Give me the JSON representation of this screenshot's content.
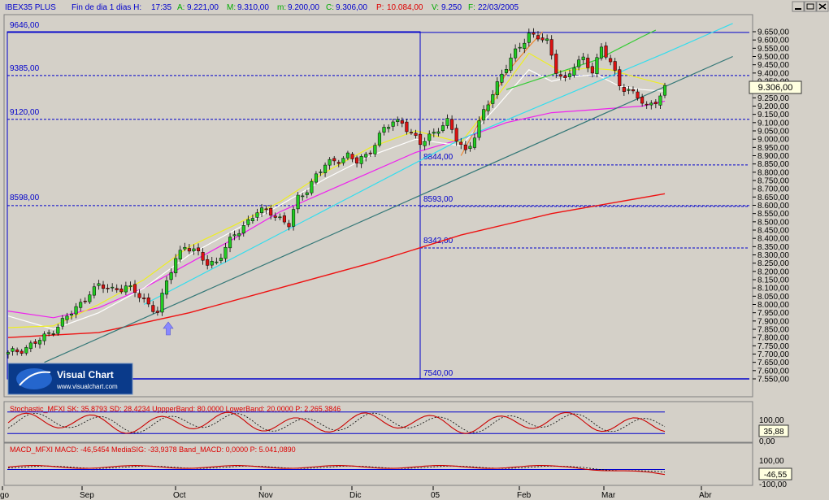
{
  "window": {
    "info": {
      "symbol": "IBEX35 PLUS",
      "period": "Fin de dia 1 dias H:",
      "time": "17:35",
      "a_label": "A:",
      "a_value": "9.221,00",
      "h_label": "M:",
      "h_value": "9.310,00",
      "m_label": "m:",
      "m_value": "9.200,00",
      "c_label": "C:",
      "c_value": "9.306,00",
      "p_label": "P:",
      "p_value": "10.084,00",
      "v_label": "V:",
      "v_value": "9.250",
      "f_label": "F:",
      "f_value": "22/03/2005"
    },
    "buttons": {
      "minimize": "_",
      "maximize": "□",
      "close": "×"
    }
  },
  "colors": {
    "background": "#d4d0c8",
    "grid": "#aaaaaa",
    "price_up": "#22cc22",
    "price_down": "#dd1111",
    "ma_red": "#ee1111",
    "ma_magenta": "#ee22ee",
    "ma_white": "#ffffff",
    "ma_yellow": "#eeee22",
    "line_cyan": "#33ddee",
    "line_green": "#33cc33",
    "line_teal": "#337777",
    "level_line": "#0000cc",
    "label_blue": "#0000cc"
  },
  "chart_data": [
    {
      "type": "candlestick",
      "title": "IBEX35 PLUS",
      "x_labels": [
        "go",
        "Sep",
        "Oct",
        "Nov",
        "Dic",
        "05",
        "Feb",
        "Mar",
        "Abr"
      ],
      "y_ticks": [
        "9.650,00",
        "9.600,00",
        "9.550,00",
        "9.500,00",
        "9.450,00",
        "9.400,00",
        "9.350,00",
        "9.300,00",
        "9.250,00",
        "9.200,00",
        "9.150,00",
        "9.100,00",
        "9.050,00",
        "9.000,00",
        "8.950,00",
        "8.900,00",
        "8.850,00",
        "8.800,00",
        "8.750,00",
        "8.700,00",
        "8.650,00",
        "8.600,00",
        "8.550,00",
        "8.500,00",
        "8.450,00",
        "8.400,00",
        "8.350,00",
        "8.300,00",
        "8.250,00",
        "8.200,00",
        "8.150,00",
        "8.100,00",
        "8.050,00",
        "8.000,00",
        "7.950,00",
        "7.900,00",
        "7.850,00",
        "7.800,00",
        "7.750,00",
        "7.700,00",
        "7.650,00",
        "7.600,00",
        "7.550,00"
      ],
      "ylim": [
        7550,
        9650
      ],
      "last_price_label": "9.306,00",
      "level_lines": [
        {
          "label": "9646,00",
          "value": 9646
        },
        {
          "label": "9385,00",
          "value": 9385
        },
        {
          "label": "9120,00",
          "value": 9120
        },
        {
          "label": "8844,00",
          "value": 8844
        },
        {
          "label": "8598,00",
          "value": 8598
        },
        {
          "label": "8593,00",
          "value": 8593
        },
        {
          "label": "8342,00",
          "value": 8342
        },
        {
          "label": "7540,00",
          "value": 7540
        }
      ],
      "close_path": [
        [
          0,
          7700
        ],
        [
          4,
          7740
        ],
        [
          8,
          7800
        ],
        [
          12,
          7900
        ],
        [
          16,
          8000
        ],
        [
          18,
          8080
        ],
        [
          20,
          8110
        ],
        [
          23,
          8090
        ],
        [
          26,
          8110
        ],
        [
          29,
          8050
        ],
        [
          31,
          8000
        ],
        [
          33,
          7960
        ],
        [
          35,
          8130
        ],
        [
          37,
          8280
        ],
        [
          39,
          8360
        ],
        [
          42,
          8300
        ],
        [
          44,
          8250
        ],
        [
          46,
          8260
        ],
        [
          48,
          8340
        ],
        [
          50,
          8420
        ],
        [
          52,
          8480
        ],
        [
          55,
          8560
        ],
        [
          58,
          8560
        ],
        [
          60,
          8520
        ],
        [
          62,
          8480
        ],
        [
          64,
          8640
        ],
        [
          66,
          8700
        ],
        [
          68,
          8780
        ],
        [
          70,
          8840
        ],
        [
          72,
          8870
        ],
        [
          75,
          8900
        ],
        [
          77,
          8860
        ],
        [
          79,
          8900
        ],
        [
          81,
          8980
        ],
        [
          83,
          9060
        ],
        [
          85,
          9100
        ],
        [
          87,
          9110
        ],
        [
          89,
          9030
        ],
        [
          91,
          8970
        ],
        [
          93,
          9020
        ],
        [
          95,
          9070
        ],
        [
          97,
          9100
        ],
        [
          99,
          9000
        ],
        [
          101,
          8930
        ],
        [
          103,
          9020
        ],
        [
          105,
          9160
        ],
        [
          107,
          9280
        ],
        [
          109,
          9400
        ],
        [
          111,
          9480
        ],
        [
          113,
          9560
        ],
        [
          115,
          9640
        ],
        [
          117,
          9620
        ],
        [
          119,
          9580
        ],
        [
          121,
          9420
        ],
        [
          123,
          9360
        ],
        [
          125,
          9440
        ],
        [
          127,
          9480
        ],
        [
          129,
          9420
        ],
        [
          131,
          9550
        ],
        [
          133,
          9460
        ],
        [
          135,
          9330
        ],
        [
          137,
          9300
        ],
        [
          139,
          9250
        ],
        [
          141,
          9190
        ],
        [
          143,
          9240
        ],
        [
          145,
          9306
        ]
      ],
      "series": [
        {
          "name": "",
          "color": "#ee1111",
          "values": [
            [
              0,
              7800
            ],
            [
              20,
              7830
            ],
            [
              40,
              7950
            ],
            [
              60,
              8100
            ],
            [
              80,
              8250
            ],
            [
              100,
              8420
            ],
            [
              120,
              8550
            ],
            [
              145,
              8670
            ]
          ]
        },
        {
          "name": "",
          "color": "#ee22ee",
          "values": [
            [
              0,
              7960
            ],
            [
              10,
              7920
            ],
            [
              20,
              7980
            ],
            [
              30,
              8100
            ],
            [
              40,
              8250
            ],
            [
              50,
              8400
            ],
            [
              60,
              8560
            ],
            [
              70,
              8680
            ],
            [
              80,
              8800
            ],
            [
              90,
              8920
            ],
            [
              100,
              9000
            ],
            [
              110,
              9100
            ],
            [
              120,
              9160
            ],
            [
              130,
              9180
            ],
            [
              140,
              9200
            ],
            [
              145,
              9230
            ]
          ]
        },
        {
          "name": "",
          "color": "#ffffff",
          "values": [
            [
              0,
              7930
            ],
            [
              10,
              7850
            ],
            [
              20,
              7950
            ],
            [
              30,
              8100
            ],
            [
              40,
              8300
            ],
            [
              50,
              8450
            ],
            [
              60,
              8600
            ],
            [
              70,
              8760
            ],
            [
              80,
              8900
            ],
            [
              90,
              9000
            ],
            [
              100,
              8960
            ],
            [
              108,
              9200
            ],
            [
              115,
              9420
            ],
            [
              120,
              9350
            ],
            [
              125,
              9380
            ],
            [
              130,
              9390
            ],
            [
              135,
              9320
            ],
            [
              140,
              9300
            ],
            [
              145,
              9290
            ]
          ]
        },
        {
          "name": "",
          "color": "#eeee22",
          "values": [
            [
              0,
              7860
            ],
            [
              10,
              7870
            ],
            [
              20,
              8000
            ],
            [
              30,
              8150
            ],
            [
              40,
              8350
            ],
            [
              50,
              8480
            ],
            [
              60,
              8620
            ],
            [
              70,
              8800
            ],
            [
              80,
              8950
            ],
            [
              90,
              9050
            ],
            [
              100,
              8980
            ],
            [
              108,
              9260
            ],
            [
              115,
              9520
            ],
            [
              122,
              9410
            ],
            [
              128,
              9430
            ],
            [
              133,
              9420
            ],
            [
              138,
              9380
            ],
            [
              145,
              9330
            ]
          ]
        },
        {
          "name": "",
          "color": "#ee8833",
          "values": [
            [
              100,
              8900
            ],
            [
              105,
              9150
            ],
            [
              110,
              9400
            ],
            [
              115,
              9560
            ],
            [
              118,
              9650
            ]
          ]
        },
        {
          "name": "",
          "color": "#33ddee",
          "values": [
            [
              30,
              8000
            ],
            [
              100,
              9000
            ],
            [
              145,
              9520
            ],
            [
              160,
              9700
            ]
          ]
        },
        {
          "name": "",
          "color": "#33cc33",
          "values": [
            [
              110,
              9300
            ],
            [
              130,
              9480
            ],
            [
              140,
              9620
            ],
            [
              143,
              9660
            ]
          ]
        },
        {
          "name": "",
          "color": "#337777",
          "values": [
            [
              8,
              7650
            ],
            [
              160,
              9500
            ]
          ]
        }
      ]
    },
    {
      "type": "line",
      "title": "Stochastic_MFXI",
      "legend_text": "Stochastic_MFXI  SK: 35,8793  SD: 28,4234  UppperBand: 80,0000  LowerBand: 20,0000  P: 2.265,3846",
      "ylim": [
        0,
        100
      ],
      "y_ticks": [
        "100,00",
        "35,88",
        "0,00"
      ],
      "bands": [
        80,
        20
      ],
      "last_value": "35,88"
    },
    {
      "type": "line",
      "title": "MACD_MFXI",
      "legend_text": "MACD_MFXI  MACD: -46,5454  MediaSIG: -33,9378  Band_MACD: 0,0000  P: 5.041,0890",
      "ylim": [
        -100,
        100
      ],
      "y_ticks": [
        "100,00",
        "-46,55",
        "-100,00"
      ],
      "bands": [
        0
      ],
      "last_value": "-46,55"
    }
  ],
  "logo": {
    "title": "Visual Chart",
    "url": "www.visualchart.com"
  }
}
